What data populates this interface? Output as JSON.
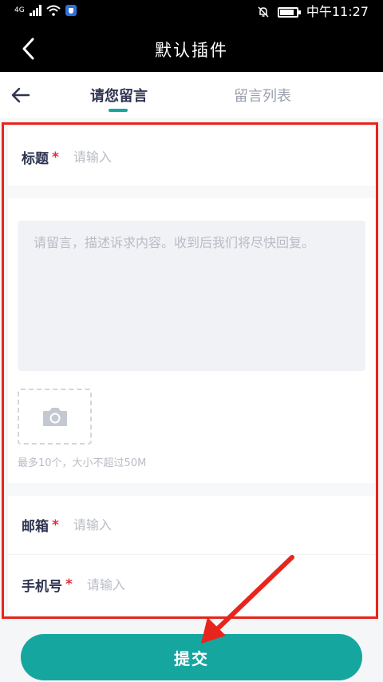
{
  "status_bar": {
    "network": "4G",
    "clock": "中午11:27",
    "battery_level": 0.85
  },
  "title_bar": {
    "title": "默认插件"
  },
  "tabs": [
    {
      "label": "请您留言",
      "active": true
    },
    {
      "label": "留言列表",
      "active": false
    }
  ],
  "form": {
    "title_field": {
      "label": "标题",
      "required_mark": "*",
      "placeholder": "请输入"
    },
    "message": {
      "placeholder": "请留言，描述诉求内容。收到后我们将尽快回复。"
    },
    "upload": {
      "hint": "最多10个，大小不超过50M"
    },
    "email_field": {
      "label": "邮箱",
      "required_mark": "*",
      "placeholder": "请输入"
    },
    "phone_field": {
      "label": "手机号",
      "required_mark": "*",
      "placeholder": "请输入"
    }
  },
  "submit_label": "提交",
  "colors": {
    "accent": "#16a6a0",
    "highlight": "#e8251c",
    "required": "#e0303a",
    "header_bg": "#000000"
  }
}
